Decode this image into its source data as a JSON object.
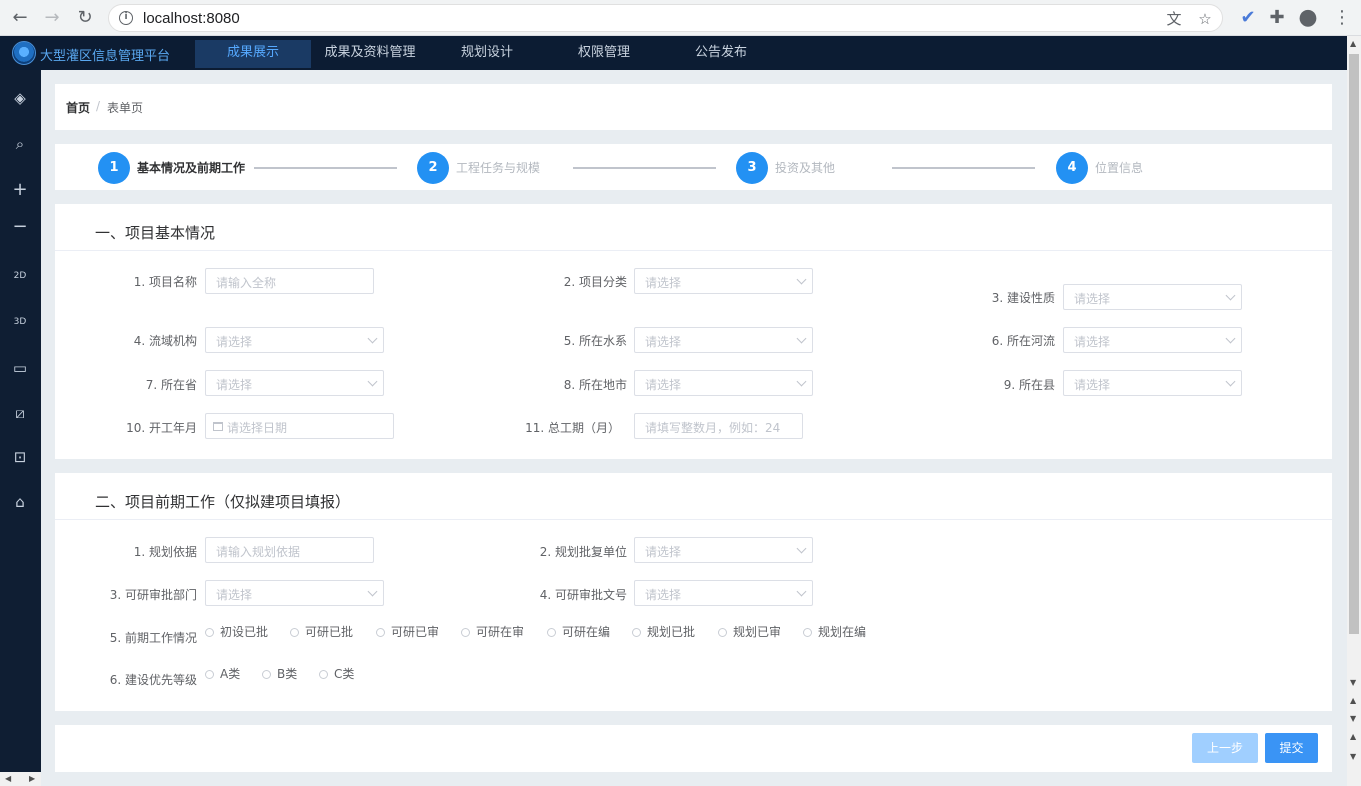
{
  "browser": {
    "url": "localhost:8080"
  },
  "app": {
    "title": "大型灌区信息管理平台",
    "nav": [
      "成果展示",
      "成果及资料管理",
      "规划设计",
      "权限管理",
      "公告发布"
    ]
  },
  "breadcrumb": {
    "home": "首页",
    "separator": "/",
    "current": "表单页"
  },
  "steps": [
    {
      "num": "1",
      "title": "基本情况及前期工作"
    },
    {
      "num": "2",
      "title": "工程任务与规模"
    },
    {
      "num": "3",
      "title": "投资及其他"
    },
    {
      "num": "4",
      "title": "位置信息"
    }
  ],
  "section1": {
    "title": "一、项目基本情况",
    "fields": [
      {
        "label": "1. 项目名称",
        "placeholder": "请输入全称"
      },
      {
        "label": "2. 项目分类",
        "placeholder": "请选择"
      },
      {
        "label": "3. 建设性质",
        "placeholder": "请选择"
      },
      {
        "label": "4. 流域机构",
        "placeholder": "请选择"
      },
      {
        "label": "5. 所在水系",
        "placeholder": "请选择"
      },
      {
        "label": "6. 所在河流",
        "placeholder": "请选择"
      },
      {
        "label": "7. 所在省",
        "placeholder": "请选择"
      },
      {
        "label": "8. 所在地市",
        "placeholder": "请选择"
      },
      {
        "label": "9. 所在县",
        "placeholder": "请选择"
      },
      {
        "label": "10. 开工年月",
        "placeholder": "请选择日期"
      },
      {
        "label": "11. 总工期（月）",
        "placeholder": "请填写整数月，例如：24"
      }
    ]
  },
  "section2": {
    "title": "二、项目前期工作（仅拟建项目填报）",
    "fields": [
      {
        "label": "1. 规划依据",
        "placeholder": "请输入规划依据"
      },
      {
        "label": "2. 规划批复单位",
        "placeholder": "请选择"
      },
      {
        "label": "3. 可研审批部门",
        "placeholder": "请选择"
      },
      {
        "label": "4. 可研审批文号",
        "placeholder": "请选择"
      }
    ],
    "prep_label": "5. 前期工作情况",
    "prep_options": [
      "初设已批",
      "可研已批",
      "可研已审",
      "可研在审",
      "可研在编",
      "规划已批",
      "规划已审",
      "规划在编"
    ],
    "priority_label": "6. 建设优先等级",
    "priority_options": [
      "A类",
      "B类",
      "C类"
    ]
  },
  "footer": {
    "prev": "上一步",
    "submit": "提交"
  }
}
